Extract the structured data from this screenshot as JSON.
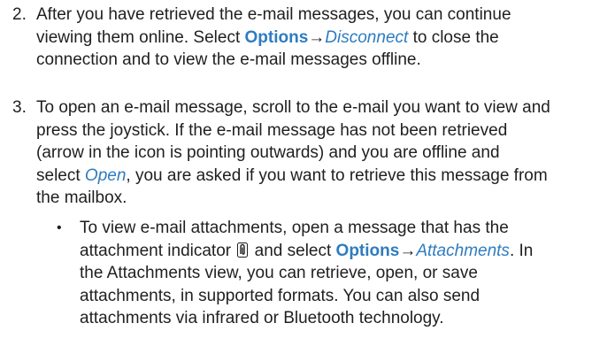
{
  "step2": {
    "number": "2.",
    "line1": "After you have retrieved the e-mail messages, you can continue",
    "line2_pre": "viewing them online. Select ",
    "line2_kw": "Options",
    "line2_arrow": "→",
    "line2_it": "Disconnect",
    "line2_post": " to close the",
    "line3": "connection and to view the e-mail messages offline."
  },
  "step3": {
    "number": "3.",
    "line1": "To open an e-mail message, scroll to the e-mail you want to view and",
    "line2": "press the joystick. If the e-mail message has not been retrieved",
    "line3": "(arrow in the icon is pointing outwards) and you are offline and",
    "line4_pre": "select ",
    "line4_it": "Open",
    "line4_post": ", you are asked if you want to retrieve this message from",
    "line5": "the mailbox."
  },
  "bullet": {
    "dot": "•",
    "line1": "To view e-mail attachments, open a message that has the",
    "line2_pre": "attachment indicator ",
    "icon": "paperclip-icon",
    "line2_mid": " and select ",
    "line2_kw": "Options",
    "line2_arrow": "→",
    "line2_it": "Attachments",
    "line2_post": ". In",
    "line3": "the Attachments view, you can retrieve, open, or save",
    "line4": "attachments, in supported formats. You can also send",
    "line5": "attachments via infrared or Bluetooth technology."
  },
  "colors": {
    "accent": "#2e7cc0",
    "text": "#1f1f1f"
  }
}
